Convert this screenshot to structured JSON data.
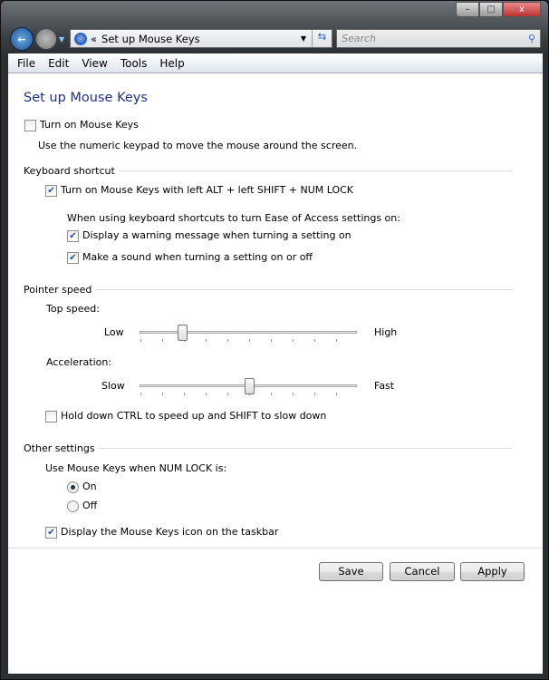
{
  "window": {
    "minimize": "–",
    "maximize": "□",
    "close": "x"
  },
  "address": {
    "crumb_prefix": "«",
    "path": "Set up Mouse Keys",
    "search_placeholder": "Search"
  },
  "menu": [
    "File",
    "Edit",
    "View",
    "Tools",
    "Help"
  ],
  "page": {
    "title": "Set up Mouse Keys",
    "turn_on": {
      "label": "Turn on Mouse Keys",
      "checked": false
    },
    "description": "Use the numeric keypad to move the mouse around the screen.",
    "keyboard_shortcut": {
      "heading": "Keyboard shortcut",
      "shortcut": {
        "label": "Turn on Mouse Keys with left ALT + left SHIFT + NUM LOCK",
        "checked": true
      },
      "note": "When using keyboard shortcuts to turn Ease of Access settings on:",
      "warning": {
        "label": "Display a warning message when turning a setting on",
        "checked": true
      },
      "sound": {
        "label": "Make a sound when turning a setting on or off",
        "checked": true
      }
    },
    "pointer_speed": {
      "heading": "Pointer speed",
      "top_speed": {
        "label": "Top speed:",
        "min_label": "Low",
        "max_label": "High",
        "value_percent": 18
      },
      "acceleration": {
        "label": "Acceleration:",
        "min_label": "Slow",
        "max_label": "Fast",
        "value_percent": 50
      },
      "ctrl_shift": {
        "label": "Hold down CTRL to speed up and SHIFT to slow down",
        "checked": false
      }
    },
    "other": {
      "heading": "Other settings",
      "numlock_label": "Use Mouse Keys when NUM LOCK is:",
      "on": {
        "label": "On",
        "selected": true
      },
      "off": {
        "label": "Off",
        "selected": false
      },
      "taskbar_icon": {
        "label": "Display the Mouse Keys icon on the taskbar",
        "checked": true
      }
    }
  },
  "buttons": {
    "save": "Save",
    "cancel": "Cancel",
    "apply": "Apply"
  }
}
